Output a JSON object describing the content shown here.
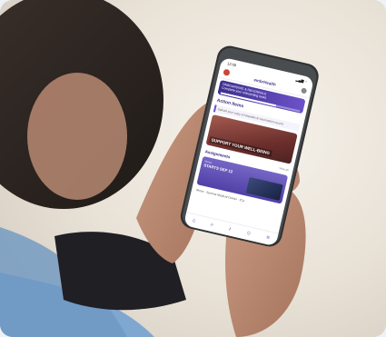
{
  "phone_screen": {
    "status": {
      "time": "12:09",
      "icons": "▂▄▆ ◔"
    },
    "header": {
      "app_name": "embrHealth"
    },
    "banner": {
      "title": "ONBOARDING & REFERRALS",
      "subtitle": "Complete your onboarding tasks"
    },
    "action_items": {
      "title": "Action Items",
      "task": "Upload your copy of Hepatitis B vaccination record"
    },
    "card": {
      "label": "SUPPORT YOUR WELL-BEING"
    },
    "assignments": {
      "title": "Assignments",
      "view_all": "View all"
    },
    "assignment_card": {
      "tag": "Nurse",
      "title": "STARTS SEP 12"
    },
    "location": "Akron · Summa Medical Center · ICU",
    "nav_icons": [
      "home-icon",
      "search-icon",
      "bell-icon",
      "people-icon",
      "menu-icon"
    ]
  }
}
